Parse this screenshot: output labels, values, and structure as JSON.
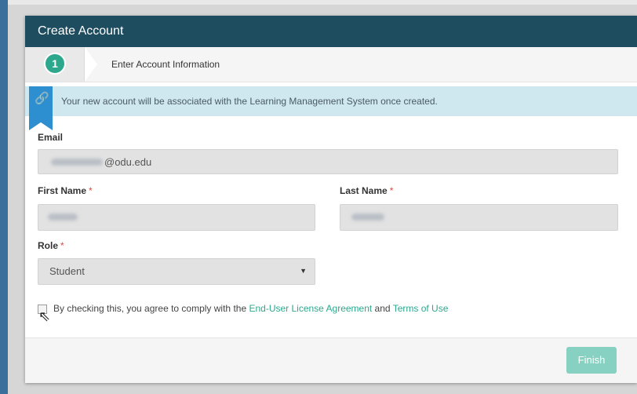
{
  "dialog": {
    "title": "Create Account",
    "step": {
      "number": "1",
      "label": "Enter Account Information"
    },
    "info": "Your new account will be associated with the Learning Management System once created.",
    "email": {
      "label": "Email",
      "value_domain": "@odu.edu"
    },
    "first_name": {
      "label": "First Name",
      "required": "*"
    },
    "last_name": {
      "label": "Last Name",
      "required": "*"
    },
    "role": {
      "label": "Role",
      "required": "*",
      "value": "Student"
    },
    "agreement": {
      "prefix": "By checking this, you agree to comply with the ",
      "eula": "End-User License Agreement",
      "and": " and ",
      "terms": "Terms of Use"
    },
    "finish_label": "Finish"
  },
  "colors": {
    "header": "#1f4d60",
    "accent": "#2ea88d",
    "info_bg": "#cfe8ef",
    "ribbon": "#2d8fd0",
    "finish_bg": "#86d1c1"
  },
  "icons": {
    "ribbon": "link-icon",
    "select": "chevron-down-icon",
    "cursor": "mouse-pointer-icon"
  }
}
